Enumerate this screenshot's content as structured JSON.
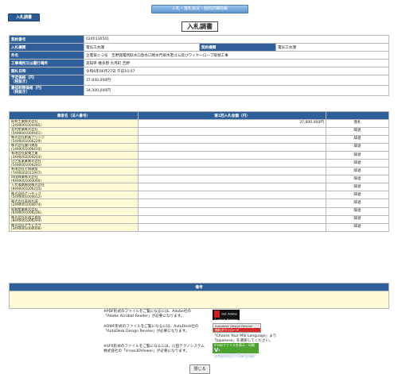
{
  "header": {
    "banner": "入札・落札状況・個別詳細情報",
    "tab_label": "入札調書",
    "title": "入札調書"
  },
  "info_rows": [
    {
      "label": "契約番号",
      "value": "0240130501"
    },
    {
      "label": "入札機関",
      "value": "電気工水課",
      "label2": "契約機関",
      "value2": "電気工水課"
    },
    {
      "label": "件名",
      "value": "企電第ニ-2号　吉野発電所取水口放水口制水門扉水密ゴム及びワイヤーロープ取替工事"
    },
    {
      "label": "工事場所又は履行場所",
      "value": "高知県 幡多郡 大月町 吉野"
    },
    {
      "label": "開札日時",
      "value": "令和6年06月27日 午前10:07"
    },
    {
      "label": "予定価格（円）",
      "label_sub": "（税抜き）",
      "value": "37,840,000円"
    },
    {
      "label": "最低制限価格（円）",
      "label_sub": "（税抜き）",
      "value": "34,300,000円"
    }
  ],
  "bid_table": {
    "col_name": "業者名（法人番号）",
    "col_amount": "第1回入札金額（円）",
    "rows": [
      {
        "name": "昭和工業株式会社",
        "id": "(2490001004485)",
        "amount": "37,800,000円",
        "result": "落札"
      },
      {
        "name": "北村産業株式会社",
        "id": "(5490001000441)",
        "amount": "",
        "result": "辞退"
      },
      {
        "name": "株式会社創風ブリッジ",
        "id": "(5490001006229)",
        "amount": "",
        "result": "辞退"
      },
      {
        "name": "株式会社轟川建設",
        "id": "(1490001006410)",
        "amount": "",
        "result": "辞退"
      },
      {
        "name": "有限会社愛電工業",
        "id": "(3490002000203)",
        "amount": "",
        "result": "辞退"
      },
      {
        "name": "日之出薬業株式会社",
        "id": "(5490001006291)",
        "amount": "",
        "result": "辞退"
      },
      {
        "name": "有限会社七和建設",
        "id": "(7490002011907)",
        "amount": "",
        "result": "辞退"
      },
      {
        "name": "四国興業株式会社",
        "id": "(9490001003060)",
        "amount": "",
        "result": "辞退"
      },
      {
        "name": "入交道路施設株式会社",
        "id": "(9490001006215)",
        "amount": "",
        "result": "辞退"
      },
      {
        "name": "株式会社ケーテック",
        "id": "(5490001004612)",
        "amount": "",
        "result": "辞退"
      },
      {
        "name": "株式会社高知丸高",
        "id": "(2490001004674)",
        "amount": "",
        "result": "辞退"
      },
      {
        "name": "昭和産業株式会社",
        "id": "(6490001006236)",
        "amount": "",
        "result": "辞退"
      },
      {
        "name": "株式会社水道工務店",
        "id": "(8490001006394)",
        "amount": "",
        "result": "辞退"
      },
      {
        "name": "株式会社アサヒガワ",
        "id": "(3490001000006)",
        "amount": "",
        "result": "辞退"
      }
    ]
  },
  "remarks": {
    "heading": "備考",
    "text": ""
  },
  "notes": {
    "pdf": "※PDF形式のファイルをご覧になるには、Adobe社の「Adobe Acrobat Reader」が必要になります。",
    "dwf": "※DWF形式のファイルをご覧になるには、AutoDesk社の「AutoDesk Design Review」が必要になります。",
    "dwf_lang": "「Choose Your MSI Language」より「Japanese」を選択してください。",
    "sfx": "※SFX形式のファイルをご覧になるには、川田テクノシステム株式会社の「V-nas3DViewer」が必要になります。"
  },
  "badges": {
    "adobe_top": "Get Adobe",
    "adobe_bottom": "Acrobat Reader",
    "adr_top": "Autodesk Design Review",
    "adr_bottom": "無料ダウンロード",
    "v3d_top": "V-nasファイルを表示・印刷",
    "v3d_name": "V-nas3DViewer",
    "v3d_bottom": "ダウンロードはこちら"
  },
  "close_label": "閉じる",
  "colors": {
    "header_blue": "#2f5f99",
    "row_yellow": "#fffbd6"
  }
}
